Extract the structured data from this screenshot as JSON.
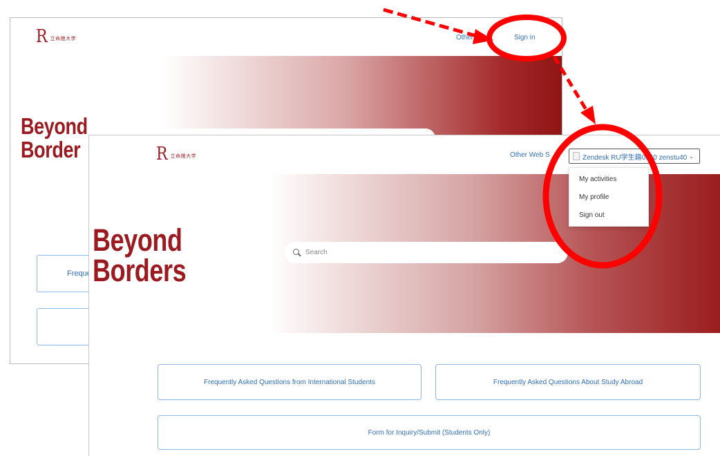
{
  "back_window": {
    "logo_mark": "R",
    "logo_text": "立命館大学",
    "other_link": "Other W",
    "signin_link": "Sign in",
    "tagline_line1": "Beyond",
    "tagline_line2": "Border",
    "card_faq_partial": "Freque"
  },
  "front_window": {
    "logo_mark": "R",
    "logo_text": "立命館大学",
    "other_link": "Other Web S",
    "user_menu": {
      "label": "Zendesk RU学生籍0140 zenstu40",
      "caret": "⌄",
      "items": [
        "My activities",
        "My profile",
        "Sign out"
      ]
    },
    "tagline_line1": "Beyond",
    "tagline_line2": "Borders",
    "search": {
      "placeholder": "Search"
    },
    "cards": {
      "faq_international": "Frequently Asked Questions from International Students",
      "faq_study_abroad": "Frequently Asked Questions About Study Abroad",
      "inquiry_form": "Form for Inquiry/Submit (Students Only)"
    }
  },
  "colors": {
    "brand_red": "#9b1a1f",
    "link_blue": "#2f6fba",
    "card_border": "#8fb6e6",
    "annotation_red": "#ff0000"
  }
}
